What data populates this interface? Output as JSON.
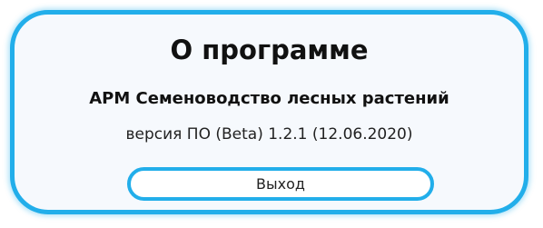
{
  "dialog": {
    "title": "О программе",
    "app_name": "АРМ Семеноводство лесных растений",
    "version": "версия ПО (Beta) 1.2.1 (12.06.2020)",
    "exit_label": "Выход"
  },
  "colors": {
    "accent": "#22aeea",
    "background": "#f6f9fd"
  }
}
